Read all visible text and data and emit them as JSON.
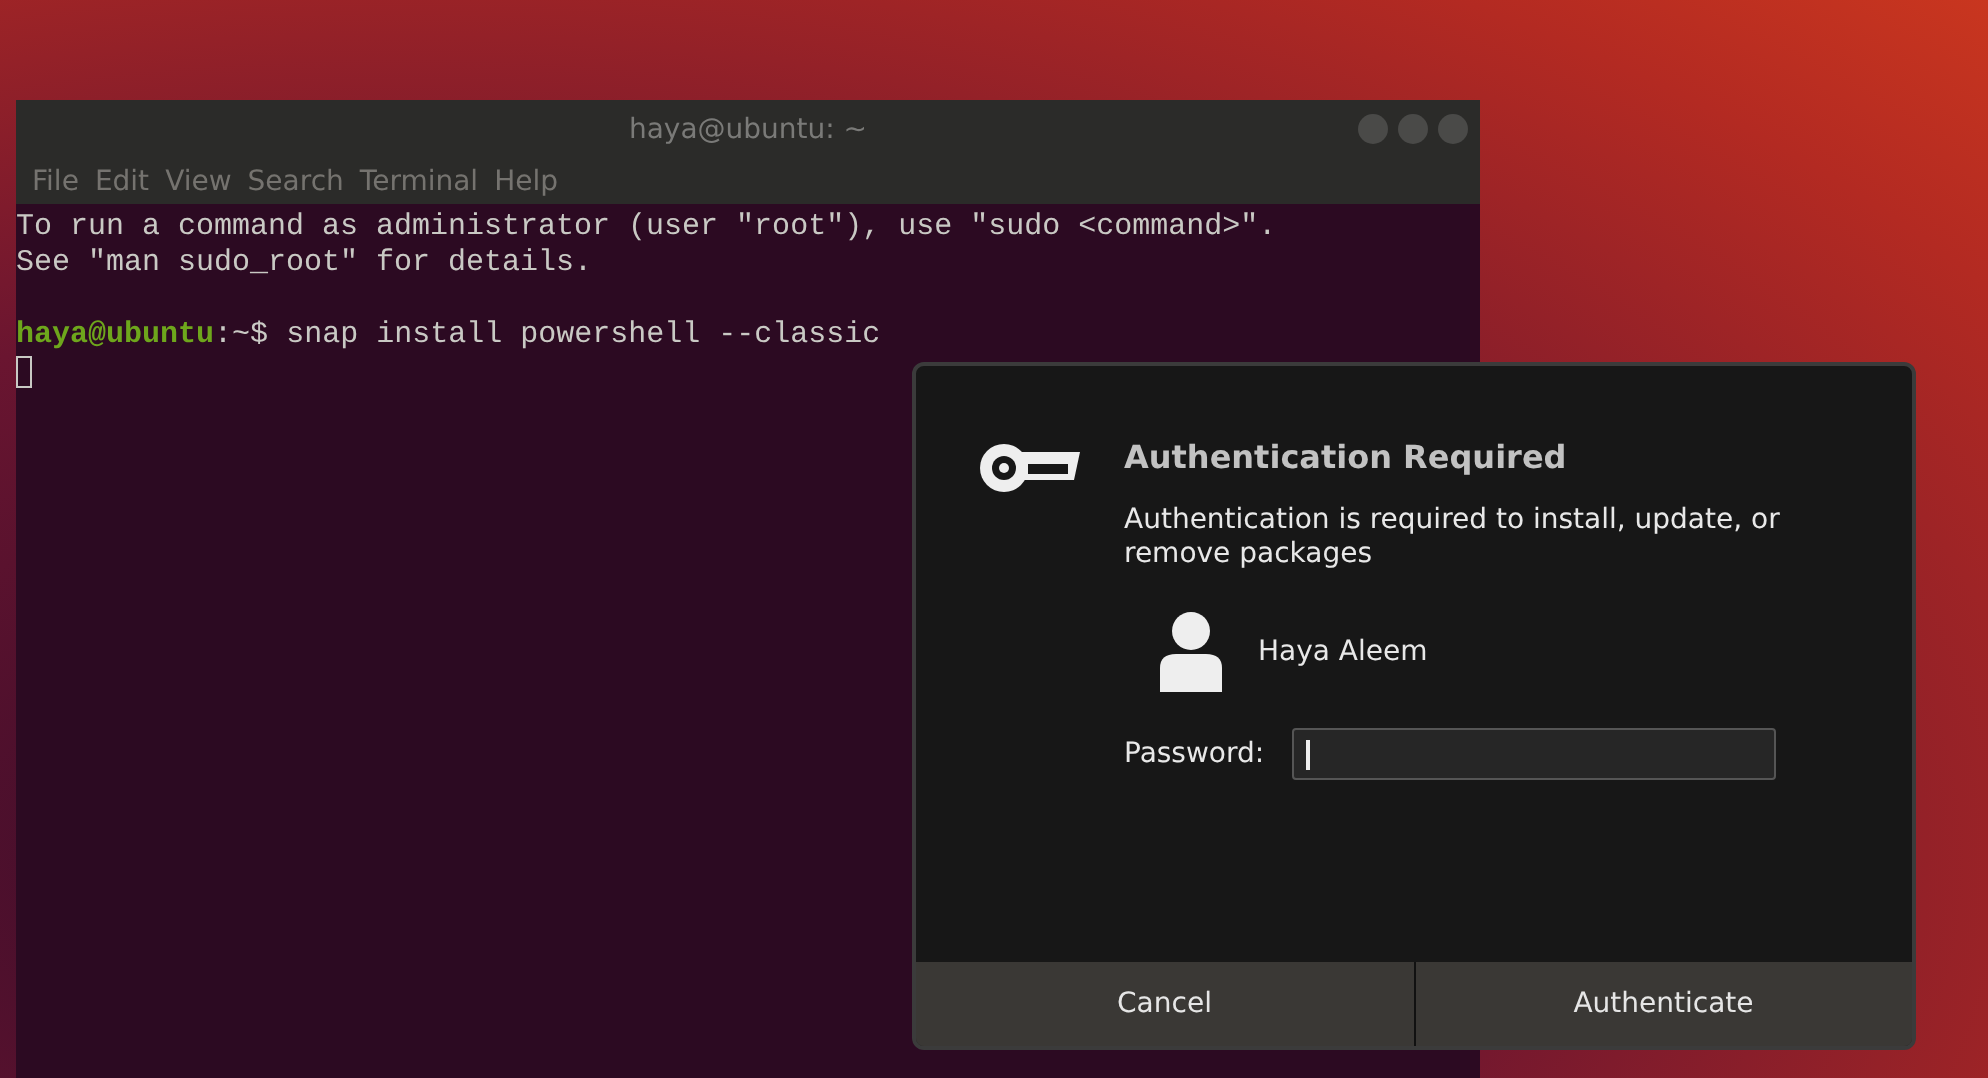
{
  "terminal": {
    "title": "haya@ubuntu: ~",
    "menu": [
      "File",
      "Edit",
      "View",
      "Search",
      "Terminal",
      "Help"
    ],
    "lines": [
      {
        "kind": "output",
        "text": "To run a command as administrator (user \"root\"), use \"sudo <command>\"."
      },
      {
        "kind": "output",
        "text": "See \"man sudo_root\" for details."
      },
      {
        "kind": "blank"
      },
      {
        "kind": "prompt",
        "user": "haya@ubuntu",
        "path": ":~$",
        "command": "snap install powershell --classic"
      },
      {
        "kind": "cursor"
      }
    ]
  },
  "dialog": {
    "title": "Authentication Required",
    "message": "Authentication is required to install, update, or remove packages",
    "user": "Haya Aleem",
    "password_label": "Password:",
    "buttons": [
      "Cancel",
      "Authenticate"
    ]
  }
}
